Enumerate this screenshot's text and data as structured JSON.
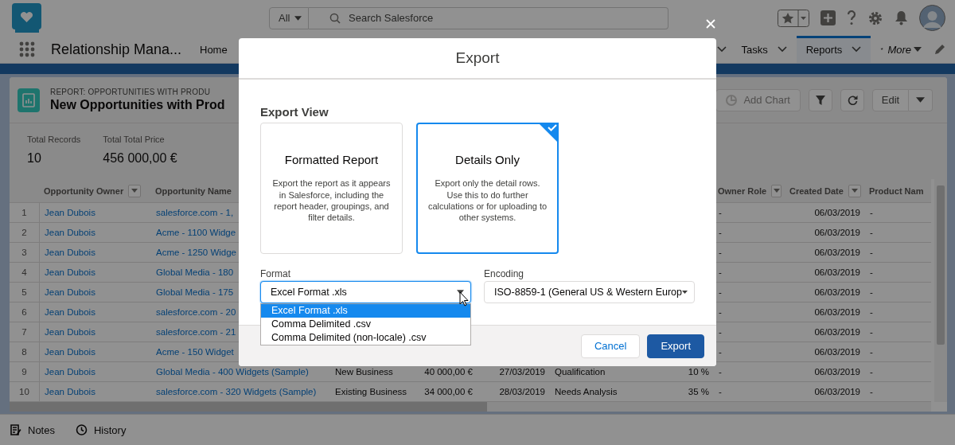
{
  "header": {
    "search_scope": "All",
    "search_placeholder": "Search Salesforce"
  },
  "nav": {
    "app_name": "Relationship Mana...",
    "tabs": [
      {
        "label": "Home",
        "chevron": false,
        "selected": false
      },
      {
        "label": "Tasks",
        "chevron": true,
        "selected": false
      },
      {
        "label": "Reports",
        "chevron": true,
        "selected": true
      }
    ],
    "more": {
      "prefix": "*",
      "label": "More"
    }
  },
  "report": {
    "eyebrow": "REPORT: OPPORTUNITIES WITH PRODU",
    "title": "New Opportunities with Prod",
    "actions": [
      {
        "label": "Add Chart",
        "disabled": true
      },
      {
        "label": "Edit",
        "disabled": false
      }
    ],
    "totals": [
      {
        "label": "Total Records",
        "value": "10"
      },
      {
        "label": "Total Total Price",
        "value": "456 000,00 €"
      }
    ]
  },
  "table": {
    "columns": [
      {
        "label": "Opportunity Owner",
        "filter": true
      },
      {
        "label": "Opportunity Name",
        "filter": false
      },
      {
        "label": "Owner Role",
        "filter": true
      },
      {
        "label": "Created Date",
        "filter": true
      },
      {
        "label": "Product Nam",
        "filter": false
      }
    ],
    "rows": [
      {
        "number": "1",
        "owner": "Jean Dubois",
        "name": "salesforce.com - 1,",
        "owner_role": "-",
        "created_date": "06/03/2019",
        "product_name": "-"
      },
      {
        "number": "2",
        "owner": "Jean Dubois",
        "name": "Acme - 1100 Widge",
        "owner_role": "-",
        "created_date": "06/03/2019",
        "product_name": "-"
      },
      {
        "number": "3",
        "owner": "Jean Dubois",
        "name": "Acme - 1250 Widge",
        "owner_role": "-",
        "created_date": "06/03/2019",
        "product_name": "-"
      },
      {
        "number": "4",
        "owner": "Jean Dubois",
        "name": "Global Media - 180",
        "owner_role": "-",
        "created_date": "06/03/2019",
        "product_name": "-"
      },
      {
        "number": "5",
        "owner": "Jean Dubois",
        "name": "Global Media - 175",
        "owner_role": "-",
        "created_date": "06/03/2019",
        "product_name": "-"
      },
      {
        "number": "6",
        "owner": "Jean Dubois",
        "name": "salesforce.com - 20",
        "owner_role": "-",
        "created_date": "06/03/2019",
        "product_name": "-"
      },
      {
        "number": "7",
        "owner": "Jean Dubois",
        "name": "salesforce.com - 21",
        "owner_role": "-",
        "created_date": "06/03/2019",
        "product_name": "-"
      },
      {
        "number": "8",
        "owner": "Jean Dubois",
        "name": "Acme - 150 Widget",
        "owner_role": "-",
        "created_date": "06/03/2019",
        "product_name": "-"
      },
      {
        "number": "9",
        "owner": "Jean Dubois",
        "name": "Global Media - 400 Widgets (Sample)",
        "column_4": "New Business",
        "column_5": "40 000,00 €",
        "column_6": "27/03/2019",
        "column_7": "Qualification",
        "column_8": "10 %",
        "owner_role": "-",
        "created_date": "06/03/2019",
        "product_name": "-"
      },
      {
        "number": "10",
        "owner": "Jean Dubois",
        "name": "salesforce.com - 320 Widgets (Sample)",
        "column_4": "Existing Business",
        "column_5": "34 000,00 €",
        "column_6": "28/03/2019",
        "column_7": "Needs Analysis",
        "column_8": "35 %",
        "owner_role": "-",
        "created_date": "06/03/2019",
        "product_name": "-"
      }
    ]
  },
  "utility_bar": [
    {
      "label": "Notes"
    },
    {
      "label": "History"
    }
  ],
  "export_dialog": {
    "title": "Export",
    "section_title": "Export View",
    "views": [
      {
        "title": "Formatted Report",
        "description": "Export the report as it appears in Salesforce, including the report header, groupings, and filter details.",
        "selected": false
      },
      {
        "title": "Details Only",
        "description": "Export only the detail rows. Use this to do further calculations or for uploading to other systems.",
        "selected": true
      }
    ],
    "format": {
      "label": "Format",
      "value": "Excel Format .xls",
      "expanded": true,
      "options": [
        {
          "label": "Excel Format .xls",
          "selected": true
        },
        {
          "label": "Comma Delimited .csv",
          "selected": false
        },
        {
          "label": "Comma Delimited (non-locale) .csv",
          "selected": false
        }
      ]
    },
    "encoding": {
      "label": "Encoding",
      "value": "ISO-8859-1 (General US & Western Europ"
    },
    "buttons": [
      {
        "label": "Cancel",
        "kind": "neutral"
      },
      {
        "label": "Export",
        "kind": "brand"
      }
    ]
  }
}
